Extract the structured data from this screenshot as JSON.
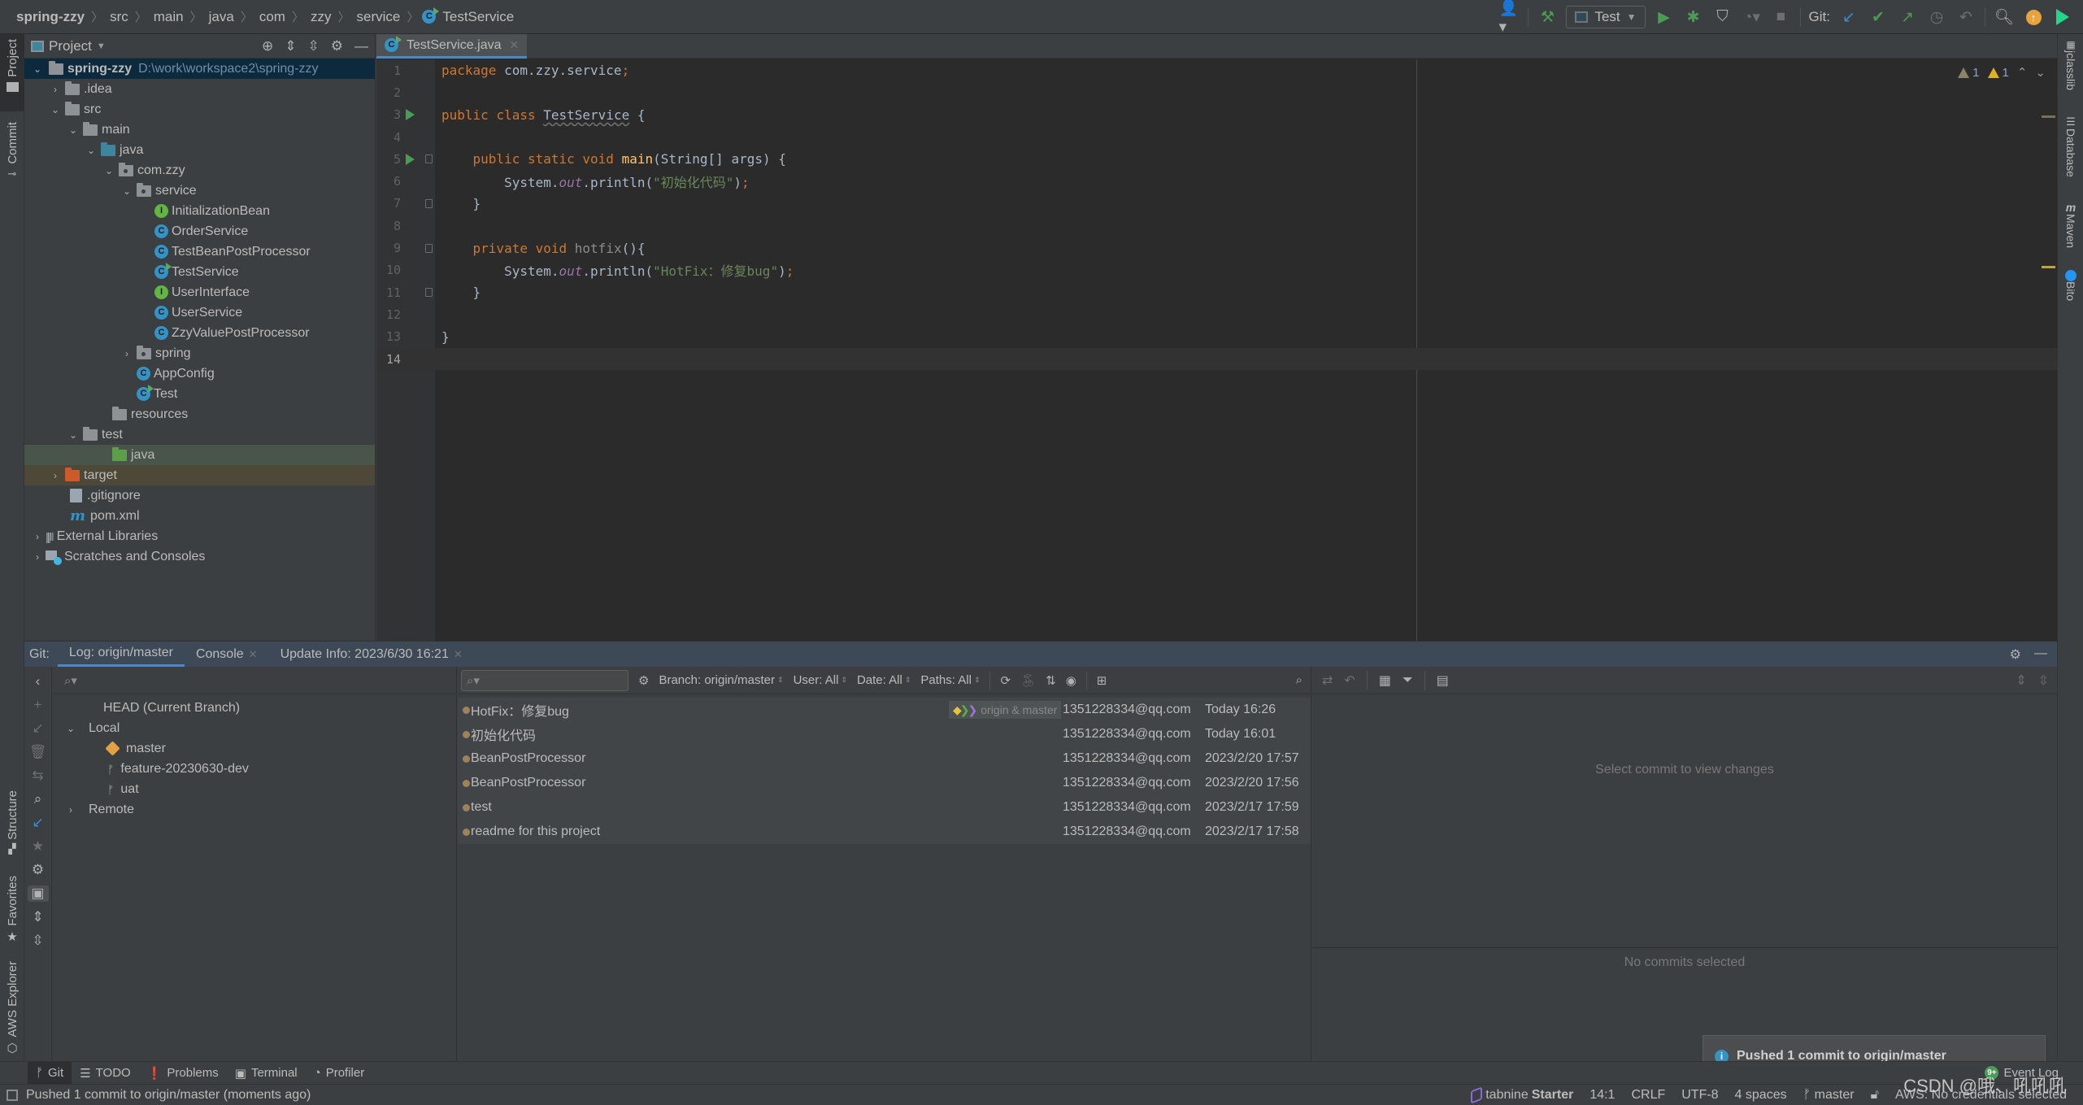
{
  "navbar": {
    "breadcrumbs": [
      "spring-zzy",
      "src",
      "main",
      "java",
      "com",
      "zzy",
      "service",
      "TestService"
    ],
    "run_config": "Test",
    "git_label": "Git:",
    "icons": [
      "user-icon",
      "build-hammer-icon",
      "run-icon",
      "debug-icon",
      "coverage-icon",
      "profile-icon",
      "stop-icon",
      "git-update-icon",
      "git-commit-icon",
      "git-push-icon",
      "history-icon",
      "rollback-icon",
      "search-icon",
      "update-available-icon",
      "toolbox-icon"
    ]
  },
  "left_stripe": {
    "top_tabs": [
      "Project",
      "Commit"
    ],
    "bottom_tabs": [
      "Structure",
      "Favorites",
      "AWS Explorer"
    ]
  },
  "right_stripe": {
    "tabs": [
      "jclasslib",
      "Database",
      "Maven",
      "Bito"
    ]
  },
  "project": {
    "title": "Project",
    "root": {
      "name": "spring-zzy",
      "path": "D:\\work\\workspace2\\spring-zzy"
    },
    "items": [
      {
        "name": ".idea",
        "type": "folder"
      },
      {
        "name": "src",
        "type": "folder"
      },
      {
        "name": "main",
        "type": "folder"
      },
      {
        "name": "java",
        "type": "source-folder"
      },
      {
        "name": "com.zzy",
        "type": "package"
      },
      {
        "name": "service",
        "type": "package"
      },
      {
        "name": "InitializationBean",
        "type": "interface"
      },
      {
        "name": "OrderService",
        "type": "class"
      },
      {
        "name": "TestBeanPostProcessor",
        "type": "class"
      },
      {
        "name": "TestService",
        "type": "class-runnable"
      },
      {
        "name": "UserInterface",
        "type": "interface"
      },
      {
        "name": "UserService",
        "type": "class"
      },
      {
        "name": "ZzyValuePostProcessor",
        "type": "class"
      },
      {
        "name": "spring",
        "type": "package"
      },
      {
        "name": "AppConfig",
        "type": "class"
      },
      {
        "name": "Test",
        "type": "class-runnable"
      },
      {
        "name": "resources",
        "type": "resources-folder"
      },
      {
        "name": "test",
        "type": "folder"
      },
      {
        "name": "java",
        "type": "test-folder"
      },
      {
        "name": "target",
        "type": "excluded-folder"
      },
      {
        "name": ".gitignore",
        "type": "file"
      },
      {
        "name": "pom.xml",
        "type": "maven"
      },
      {
        "name": "External Libraries",
        "type": "libraries"
      },
      {
        "name": "Scratches and Consoles",
        "type": "scratches"
      }
    ]
  },
  "editor": {
    "tab": "TestService.java",
    "inspections": {
      "weak_warnings": "1",
      "warnings": "1"
    },
    "cursor_line": "14",
    "lines": [
      {
        "n": "1"
      },
      {
        "n": "2"
      },
      {
        "n": "3"
      },
      {
        "n": "4"
      },
      {
        "n": "5"
      },
      {
        "n": "6"
      },
      {
        "n": "7"
      },
      {
        "n": "8"
      },
      {
        "n": "9"
      },
      {
        "n": "10"
      },
      {
        "n": "11"
      },
      {
        "n": "12"
      },
      {
        "n": "13"
      },
      {
        "n": "14"
      }
    ],
    "tokens": {
      "package_kw": "package",
      "package_name": " com.zzy.service",
      "semi": ";",
      "public": "public",
      "class_kw": "class",
      "class_name": "TestService",
      "open_brace": "{",
      "close_brace": "}",
      "static": "static",
      "void": "void",
      "main": "main",
      "main_params": "(String[] args) ",
      "system": "System.",
      "out": "out",
      "println": ".println(",
      "str1": "\"初始化代码\"",
      "close_call": ")",
      "private": "private",
      "hotfix": "hotfix",
      "hotfix_params": "(){",
      "str2": "\"HotFix：修复bug\""
    }
  },
  "git_panel": {
    "label": "Git:",
    "tabs": [
      {
        "label": "Log: origin/master",
        "active": true,
        "closable": false
      },
      {
        "label": "Console",
        "active": false,
        "closable": true
      },
      {
        "label": "Update Info: 2023/6/30 16:21",
        "active": false,
        "closable": true
      }
    ],
    "branches": {
      "head": "HEAD (Current Branch)",
      "local_label": "Local",
      "local": [
        "master",
        "feature-20230630-dev",
        "uat"
      ],
      "remote_label": "Remote"
    },
    "filters": {
      "branch": "Branch: origin/master",
      "user": "User: All",
      "date": "Date: All",
      "paths": "Paths: All"
    },
    "commits": [
      {
        "message": "HotFix：修复bug",
        "refs": "origin & master",
        "author": "1351228334@qq.com",
        "date": "Today 16:26"
      },
      {
        "message": "初始化代码",
        "refs": "",
        "author": "1351228334@qq.com",
        "date": "Today 16:01"
      },
      {
        "message": "BeanPostProcessor",
        "refs": "",
        "author": "1351228334@qq.com",
        "date": "2023/2/20 17:57"
      },
      {
        "message": "BeanPostProcessor",
        "refs": "",
        "author": "1351228334@qq.com",
        "date": "2023/2/20 17:56"
      },
      {
        "message": "test",
        "refs": "",
        "author": "1351228334@qq.com",
        "date": "2023/2/17 17:59"
      },
      {
        "message": "readme for this project",
        "refs": "",
        "author": "1351228334@qq.com",
        "date": "2023/2/17 17:58"
      }
    ],
    "changes_empty": "Select commit to view changes",
    "details_empty": "No commits selected",
    "notification": "Pushed 1 commit to origin/master"
  },
  "tool_buttons": [
    {
      "label": "Git",
      "icon": "git-branch-icon",
      "active": true
    },
    {
      "label": "TODO",
      "icon": "list-icon",
      "active": false
    },
    {
      "label": "Problems",
      "icon": "problems-icon",
      "active": false
    },
    {
      "label": "Terminal",
      "icon": "terminal-icon",
      "active": false
    },
    {
      "label": "Profiler",
      "icon": "profiler-icon",
      "active": false
    }
  ],
  "event_log": {
    "label": "Event Log",
    "badge": "9+"
  },
  "status_bar": {
    "message": "Pushed 1 commit to origin/master (moments ago)",
    "tabnine": "tabnine",
    "tabnine_plan": "Starter",
    "position": "14:1",
    "line_sep": "CRLF",
    "encoding": "UTF-8",
    "indent": "4 spaces",
    "branch": "master",
    "aws": "AWS: No credentials selected"
  },
  "watermark": "CSDN @哦、吼吼吼"
}
